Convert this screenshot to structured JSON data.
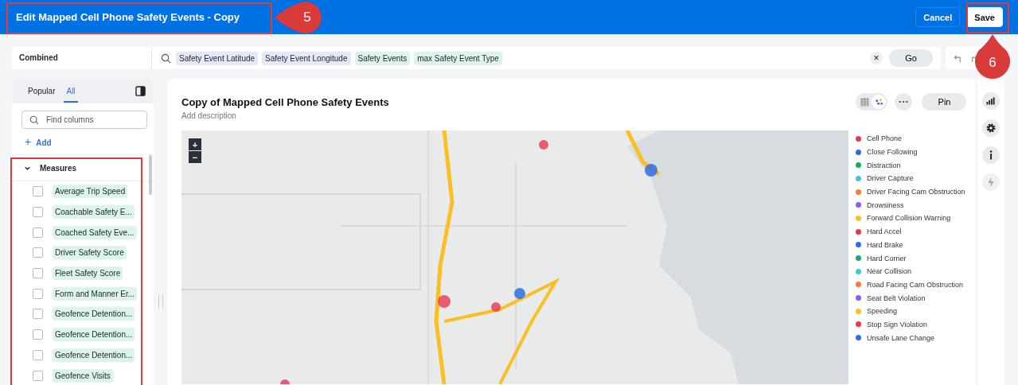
{
  "header": {
    "title": "Edit Mapped Cell Phone Safety Events - Copy",
    "buttons": [
      {
        "label": "Cancel",
        "kind": "secondary"
      },
      {
        "label": "Save",
        "kind": "primary"
      }
    ]
  },
  "callouts": [
    {
      "label": "5",
      "kind": "left"
    },
    {
      "label": "6",
      "kind": "up"
    }
  ],
  "search_bar": {
    "source": "Combined",
    "tokens": [
      {
        "label": "Safety Event Latitude",
        "kind": "attribute"
      },
      {
        "label": "Safety Event Longitude",
        "kind": "attribute"
      },
      {
        "label": "Safety Events",
        "kind": "measure"
      },
      {
        "label": "max Safety Event Type",
        "kind": "measure"
      }
    ],
    "clear": "×",
    "go": "Go"
  },
  "sidebar": {
    "tabs": [
      {
        "label": "Popular",
        "selected": false
      },
      {
        "label": "All",
        "selected": true
      }
    ],
    "search": {
      "placeholder": "Find columns"
    },
    "add_icon": "+",
    "add": "Add",
    "section": {
      "title": "Measures",
      "expanded": true,
      "items": [
        {
          "label": "Average Trip Speed",
          "checked": false
        },
        {
          "label": "Coachable Safety E...",
          "checked": false
        },
        {
          "label": "Coached Safety Eve...",
          "checked": false
        },
        {
          "label": "Driver Safety Score",
          "checked": false
        },
        {
          "label": "Fleet Safety Score",
          "checked": false
        },
        {
          "label": "Form and Manner Er...",
          "checked": false
        },
        {
          "label": "Geofence Detention...",
          "checked": false
        },
        {
          "label": "Geofence Detention...",
          "checked": false
        },
        {
          "label": "Geofence Detention...",
          "checked": false
        },
        {
          "label": "Geofence Visits",
          "checked": false
        }
      ]
    }
  },
  "answer": {
    "title": "Copy of Mapped Cell Phone Safety Events",
    "description": "Add description",
    "view_toggle": [
      {
        "kind": "table",
        "selected": false
      },
      {
        "kind": "chart",
        "selected": true
      }
    ],
    "pin": "Pin",
    "map": {
      "kind": "picture",
      "zoom_in": "+",
      "zoom_out": "−"
    },
    "legend": [
      {
        "label": "Cell Phone",
        "color": "#e8384f"
      },
      {
        "label": "Close Following",
        "color": "#2f6fe4"
      },
      {
        "label": "Distraction",
        "color": "#1aab6b"
      },
      {
        "label": "Driver Capture",
        "color": "#3cc9de"
      },
      {
        "label": "Driver Facing Cam Obstruction",
        "color": "#f57b3b"
      },
      {
        "label": "Drowsiness",
        "color": "#8b5cf6"
      },
      {
        "label": "Forward Collision Warning",
        "color": "#fbbf24"
      },
      {
        "label": "Hard Accel",
        "color": "#e8384f"
      },
      {
        "label": "Hard Brake",
        "color": "#2f6fe4"
      },
      {
        "label": "Hard Corner",
        "color": "#1aab6b"
      },
      {
        "label": "Near Collision",
        "color": "#3cc9de"
      },
      {
        "label": "Road Facing Cam Obstruction",
        "color": "#f57b3b"
      },
      {
        "label": "Seat Belt Violation",
        "color": "#8b5cf6"
      },
      {
        "label": "Speeding",
        "color": "#fbbf24"
      },
      {
        "label": "Stop Sign Violation",
        "color": "#e8384f"
      },
      {
        "label": "Unsafe Lane Change",
        "color": "#2f6fe4"
      }
    ]
  }
}
